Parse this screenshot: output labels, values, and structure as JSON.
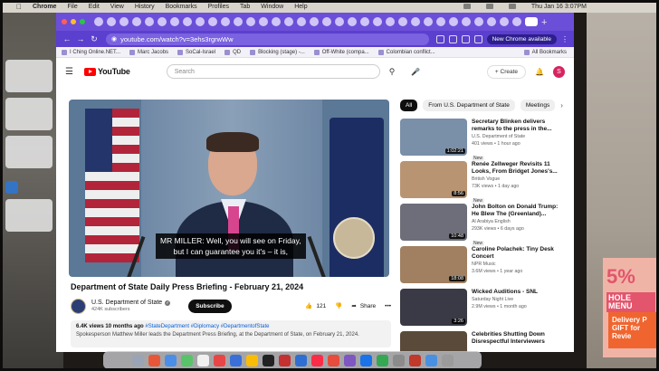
{
  "menubar": {
    "app": "Chrome",
    "items": [
      "File",
      "Edit",
      "View",
      "History",
      "Bookmarks",
      "Profiles",
      "Tab",
      "Window",
      "Help"
    ],
    "datetime": "Thu Jan 16  3:07PM"
  },
  "browser": {
    "url": "youtube.com/watch?v=3ehs3rgrwWw",
    "new_chrome_label": "New Chrome available",
    "bookmarks": [
      "I Ching Online.NET...",
      "Marc Jacobs",
      "SoCal-Israel",
      "QD",
      "Blocking (stage) -...",
      "Off-White (compa...",
      "Colombian conflict..."
    ],
    "all_bookmarks": "All Bookmarks"
  },
  "youtube": {
    "logo_text": "YouTube",
    "search_placeholder": "Search",
    "create_label": "Create",
    "avatar_initial": "S",
    "video": {
      "caption_line1": "MR MILLER: Well, you will see on Friday,",
      "caption_line2": "but I can guarantee you it's – it is,",
      "title": "Department of State Daily Press Briefing - February 21, 2024",
      "channel": "U.S. Department of State",
      "subscribers": "424K subscribers",
      "subscribe_label": "Subscribe",
      "likes": "121",
      "share_label": "Share",
      "more_label": "•••",
      "views_time": "6.4K views  10 months ago",
      "tags": "#StateDepartment #Diplomacy #DepartmentofState",
      "description": "Spokesperson Matthew Miller leads the Department Press Briefing, at the Department of State, on February 21, 2024."
    },
    "chips": [
      "All",
      "From U.S. Department of State",
      "Meetings"
    ],
    "recommendations": [
      {
        "title": "Secretary Blinken delivers remarks to the press in the...",
        "channel": "U.S. Department of State",
        "meta": "401 views • 1 hour ago",
        "badge": "New",
        "duration": "1:02:21",
        "color": "#7a8fa8"
      },
      {
        "title": "Renée Zellweger Revisits 11 Looks, From Bridget Jones's...",
        "channel": "British Vogue",
        "meta": "73K views • 1 day ago",
        "badge": "New",
        "duration": "8:56",
        "color": "#b99472"
      },
      {
        "title": "John Bolton on Donald Trump: He Blew The (Greenland)...",
        "channel": "Al Arabiya English",
        "meta": "293K views • 6 days ago",
        "badge": "New",
        "duration": "10:48",
        "color": "#6e6e7a"
      },
      {
        "title": "Caroline Polachek: Tiny Desk Concert",
        "channel": "NPR Music",
        "meta": "3.6M views • 1 year ago",
        "badge": "",
        "duration": "18:08",
        "color": "#a08060"
      },
      {
        "title": "Wicked Auditions - SNL",
        "channel": "Saturday Night Live",
        "meta": "2.9M views • 1 month ago",
        "badge": "",
        "duration": "3:26",
        "color": "#3a3a46"
      },
      {
        "title": "Celebrities Shutting Down Disrespectful Interviewers",
        "channel": "",
        "meta": "",
        "badge": "",
        "duration": "",
        "color": "#5a4a3a"
      }
    ]
  },
  "desk": {
    "card_big": "5%",
    "card_small": "HOLE MENU",
    "card_orange": "Delivery P GIFT for Revie"
  },
  "colors": {
    "chrome_accent": "#6c4fd8",
    "youtube_red": "#ff0000",
    "avatar": "#d6245f"
  }
}
